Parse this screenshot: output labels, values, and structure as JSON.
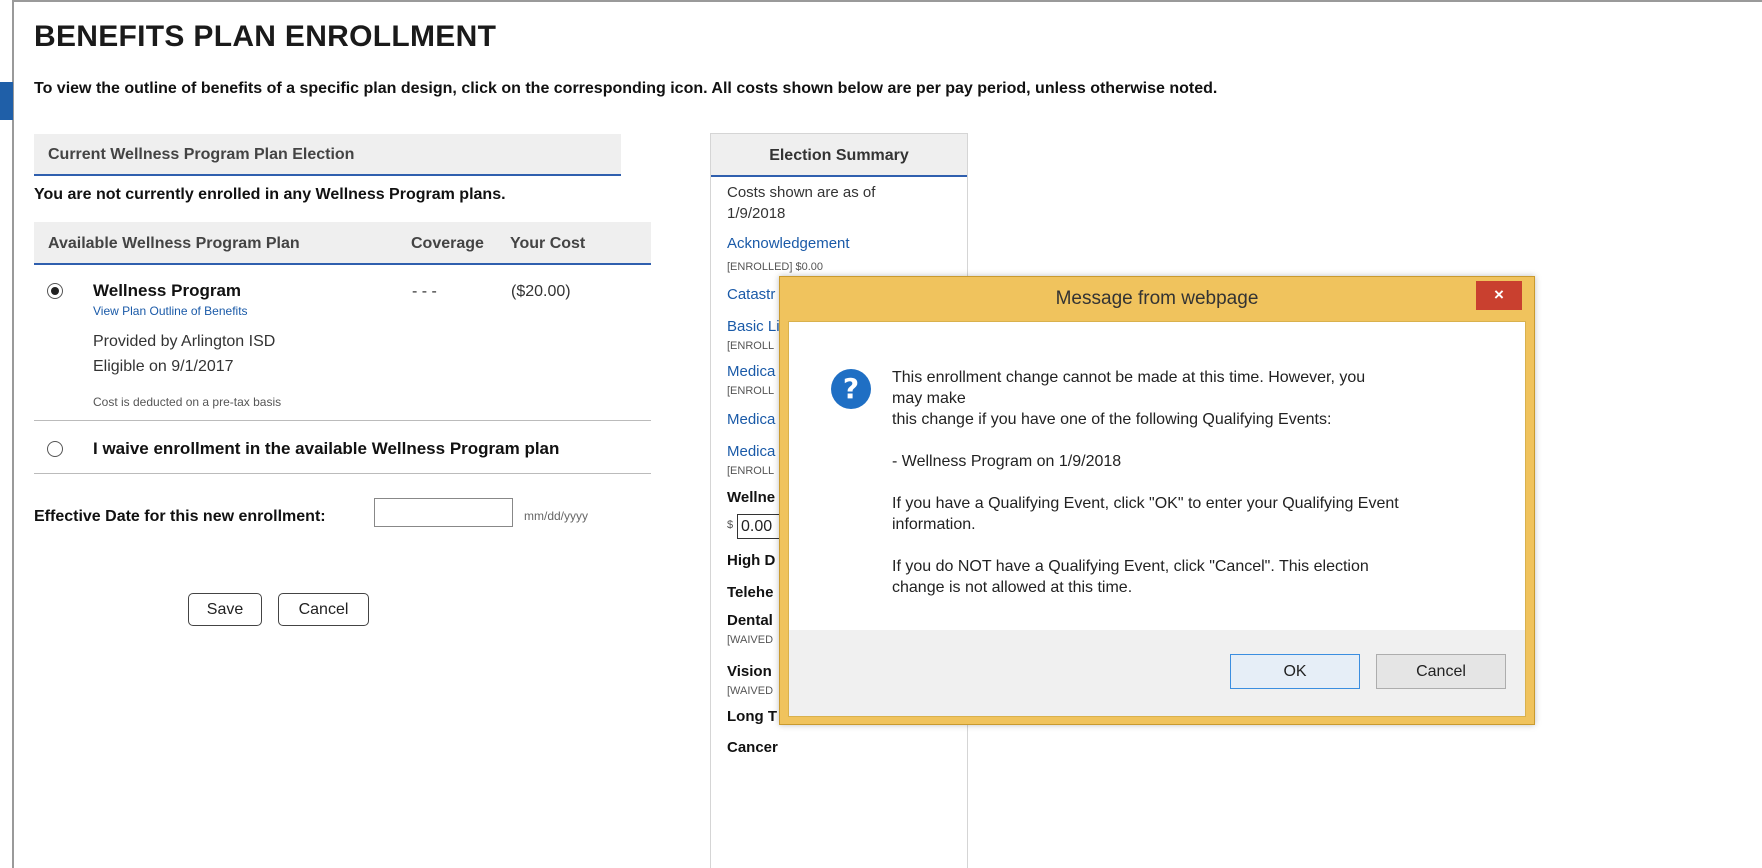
{
  "page": {
    "title": "BENEFITS PLAN ENROLLMENT",
    "intro": "To view the outline of benefits of a specific plan design, click on the corresponding icon. All costs shown below are per pay period, unless otherwise noted."
  },
  "current_election": {
    "header": "Current Wellness Program Plan Election",
    "status": "You are not currently enrolled in any Wellness Program plans."
  },
  "available": {
    "headers": {
      "plan": "Available Wellness Program Plan",
      "coverage": "Coverage",
      "cost": "Your Cost"
    },
    "plan": {
      "name": "Wellness Program",
      "link": "View Plan Outline of Benefits",
      "coverage": "- - -",
      "cost": "($20.00)",
      "provided_by": "Provided by Arlington ISD",
      "eligible": "Eligible on 9/1/2017",
      "note": "Cost is deducted on a pre-tax basis",
      "selected": true
    },
    "waive": "I waive enrollment in the available Wellness Program plan"
  },
  "effective_date": {
    "label": "Effective Date for this new enrollment:",
    "value": "",
    "hint": "mm/dd/yyyy"
  },
  "actions": {
    "save": "Save",
    "cancel": "Cancel"
  },
  "summary": {
    "header": "Election Summary",
    "as_of": "Costs shown are as of 1/9/2018",
    "items": [
      {
        "text": "Acknowledgement",
        "sub": "[ENROLLED] $0.00"
      },
      {
        "text": "Catastr"
      },
      {
        "text": "Basic Li",
        "sub": "[ENROLL"
      },
      {
        "text": "Medica",
        "sub": "[ENROLL"
      },
      {
        "text": "Medica"
      },
      {
        "text": "Medica",
        "sub": "[ENROLL"
      },
      {
        "text": "Wellne",
        "prefix": "$",
        "input_value": "0.00"
      },
      {
        "text": "High D"
      },
      {
        "text": "Telehe"
      },
      {
        "text": "Dental",
        "sub": "[WAIVED"
      },
      {
        "text": "Vision",
        "sub": "[WAIVED"
      },
      {
        "text": "Long T"
      },
      {
        "text": "Cancer"
      }
    ]
  },
  "dialog": {
    "title": "Message from webpage",
    "close": "×",
    "icon": "?",
    "message": "This enrollment change cannot be made at this time. However, you\nmay make\nthis change if you have one of the following Qualifying Events:\n\n - Wellness Program on 1/9/2018\n\nIf you have a Qualifying Event, click \"OK\" to enter your Qualifying Event\ninformation.\n\nIf you do NOT have a Qualifying Event, click \"Cancel\". This election\nchange is not allowed at this time.",
    "ok": "OK",
    "cancel": "Cancel"
  },
  "colors": {
    "accent_blue": "#2f5fae",
    "link_blue": "#1a5aa8",
    "dialog_frame": "#f0c35d",
    "close_red": "#c9402f"
  }
}
